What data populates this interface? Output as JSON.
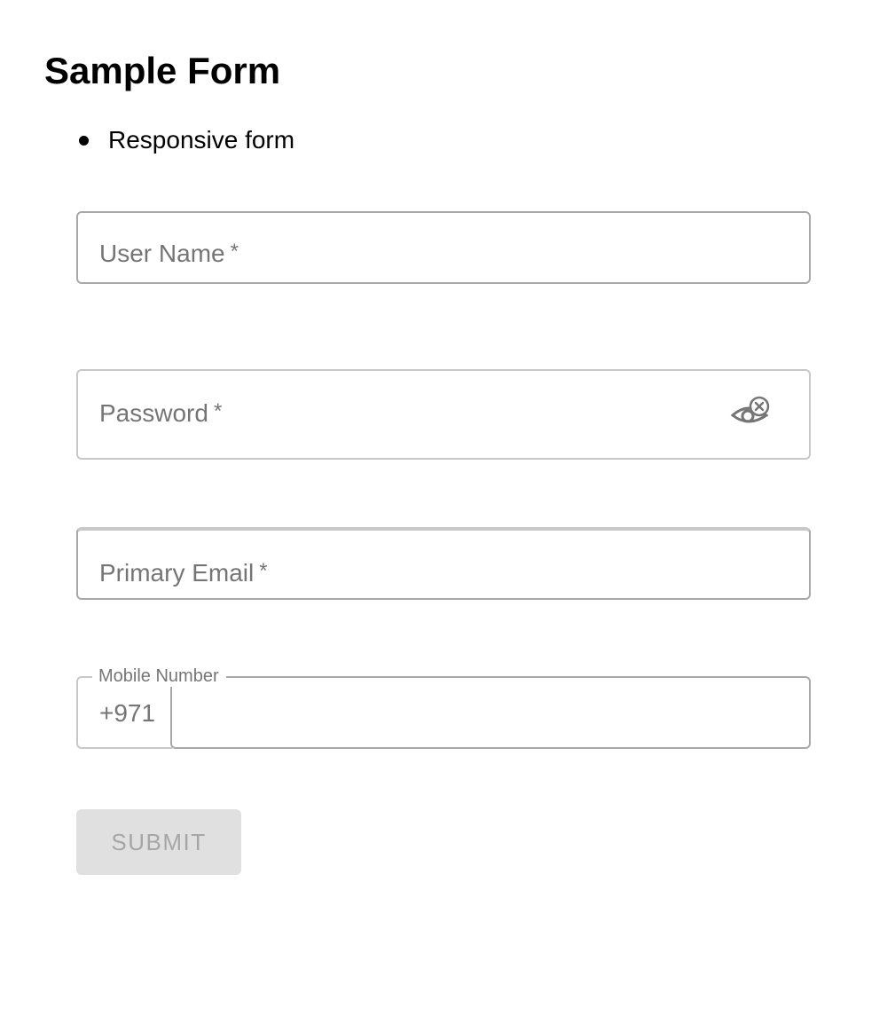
{
  "page": {
    "title": "Sample Form",
    "bullets": [
      "Responsive form"
    ]
  },
  "form": {
    "username": {
      "label": "User Name",
      "required_mark": "*",
      "value": ""
    },
    "password": {
      "label": "Password",
      "required_mark": "*",
      "value": "",
      "toggle_icon": "eye-off-icon"
    },
    "email": {
      "label": "Primary Email",
      "required_mark": "*",
      "value": ""
    },
    "mobile": {
      "label": "Mobile Number",
      "prefix": "+971",
      "value": ""
    },
    "submit_label": "SUBMIT"
  },
  "colors": {
    "label_gray": "#757575",
    "border_gray": "#a8a8a8",
    "disabled_button_bg": "#e0e0e0",
    "disabled_button_text": "#a6a6a6"
  }
}
